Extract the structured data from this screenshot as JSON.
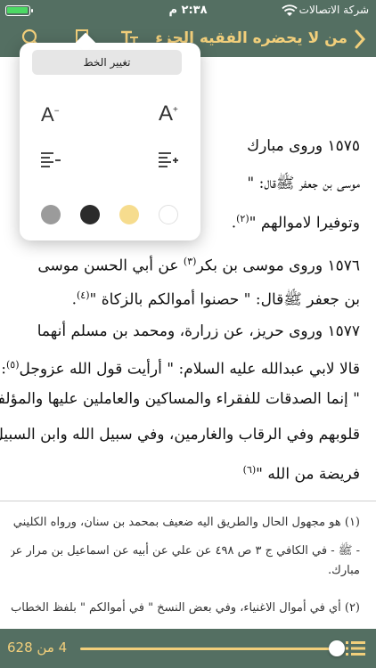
{
  "status_bar": {
    "time": "٢:٣٨ م",
    "carrier": "شركة الاتصالات",
    "battery_level": 0.95,
    "battery_color": "#4cd964"
  },
  "header": {
    "title": "من لا يحضره الفقيه الجزء",
    "icons": [
      "back-chevron-icon",
      "font-settings-icon",
      "bookmark-icon",
      "search-icon"
    ],
    "background_color": "#546f62",
    "title_color": "#f2cf7b"
  },
  "popover": {
    "change_font_label": "تغيير الخط",
    "font_decrease_label": "A",
    "font_increase_label": "A",
    "font_decrease_suffix": "−",
    "font_increase_suffix": "+",
    "spacing_decrease_icon": "line-spacing-decrease-icon",
    "spacing_increase_icon": "line-spacing-increase-icon",
    "theme_colors": [
      "#9b9b9b",
      "#2b2b2b",
      "#f6dc8e",
      "#ffffff"
    ]
  },
  "content": {
    "lines": [
      {
        "text": "١٥٧٥  وروى  مبارك"
      },
      {
        "text": "موسى بن جعفر ﷺقال: \""
      },
      {
        "text": "وتوفيرا لاموالهم \"",
        "sup": "(٢)",
        "after": "."
      },
      {
        "text": "١٥٧٦ وروى موسى بن بكر",
        "sup": "(٣)",
        "after": " عن أبي الحسن موسى"
      },
      {
        "text": "بن جعفر ﷺقال: \" حصنوا أموالكم بالزكاة \"",
        "sup": "(٤)",
        "after": "."
      },
      {
        "text": "١٥٧٧ وروى حريز، عن زرارة، ومحمد بن مسلم أنهما"
      },
      {
        "text": "قالا لابي عبدالله عليه السلام: \" أرأيت قول الله عزوجل",
        "sup": "(٥)",
        "after": ":"
      },
      {
        "text": "\" إنما الصدقات للفقراء والمساكين والعاملين عليها والمؤلفة"
      },
      {
        "text": "قلوبهم وفي الرقاب والغارمين، وفي سبيل الله وابن السبيل"
      },
      {
        "text": "فريضة من الله \"",
        "sup": "(٦)",
        "after": ""
      }
    ],
    "footnotes": [
      "(١) هو مجهول الحال والطريق اليه ضعيف بمحمد بن سنان، ورواه الكليني",
      "- ﷺ - في الكافي ج ٣ ص ٤٩٨ عن علي عن أبيه عن اسماعيل بن مرار عن",
      "مبارك.",
      "(٢) أي في أموال الاغنياء، وفي بعض النسخ \" في أموالكم \" بلفظ الخطاب كما"
    ]
  },
  "footer": {
    "page_label": "4 من 628",
    "progress": 0.006,
    "icons": [
      "list-icon"
    ]
  }
}
